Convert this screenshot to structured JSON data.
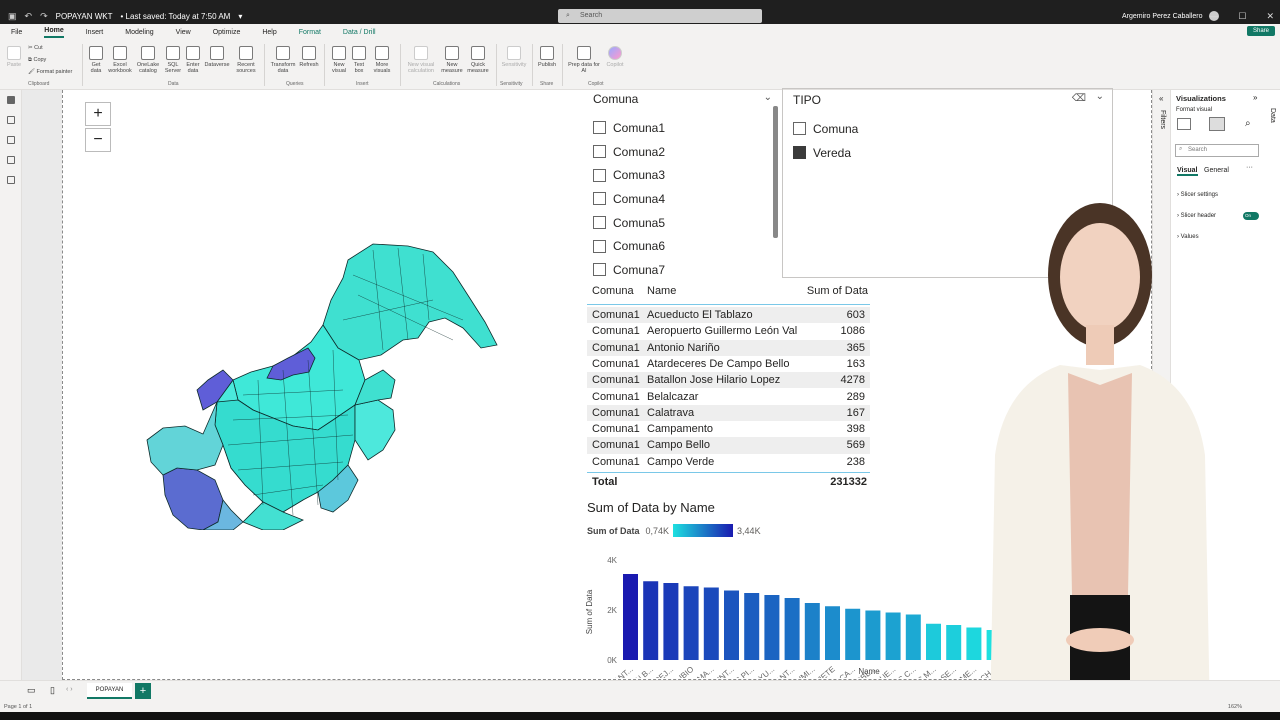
{
  "titlebar": {
    "file": "POPAYAN WKT",
    "saved": "• Last saved: Today at 7:50 AM",
    "search": "Search",
    "user": "Argemiro Perez Caballero",
    "share": "Share"
  },
  "menu": {
    "file": "File",
    "home": "Home",
    "insert": "Insert",
    "modeling": "Modeling",
    "view": "View",
    "optimize": "Optimize",
    "help": "Help",
    "format": "Format",
    "drill": "Data / Drill"
  },
  "ribbon": {
    "paste": "Paste",
    "cut": "Cut",
    "copy": "Copy",
    "format_painter": "Format painter",
    "get_data": "Get data",
    "excel": "Excel workbook",
    "onelake": "OneLake catalog",
    "sql": "SQL Server",
    "enter": "Enter data",
    "dataverse": "Dataverse",
    "recent": "Recent sources",
    "transform": "Transform data",
    "refresh": "Refresh",
    "new_visual": "New visual",
    "text_box": "Text box",
    "more_visuals": "More visuals",
    "new_calc": "New visual calculation",
    "new_measure": "New measure",
    "quick_measure": "Quick measure",
    "sensitivity": "Sensitivity",
    "publish": "Publish",
    "prep": "Prep data for AI",
    "copilot": "Copilot",
    "groups": {
      "clipboard": "Clipboard",
      "data": "Data",
      "queries": "Queries",
      "insert": "Insert",
      "calculations": "Calculations",
      "sensitivity": "Sensitivity",
      "share": "Share",
      "copilot": "Copilot"
    }
  },
  "map": {
    "zoom_in": "+",
    "zoom_out": "−"
  },
  "comuna_slicer": {
    "header": "Comuna",
    "items": [
      "Comuna1",
      "Comuna2",
      "Comuna3",
      "Comuna4",
      "Comuna5",
      "Comuna6",
      "Comuna7"
    ]
  },
  "tipo_slicer": {
    "header": "TIPO",
    "items": [
      {
        "label": "Comuna",
        "checked": false
      },
      {
        "label": "Vereda",
        "checked": true
      }
    ]
  },
  "table": {
    "headers": [
      "Comuna",
      "Name",
      "Sum of Data"
    ],
    "rows": [
      [
        "Comuna1",
        "Acueducto El Tablazo",
        "603"
      ],
      [
        "Comuna1",
        "Aeropuerto Guillermo León Val",
        "1086"
      ],
      [
        "Comuna1",
        "Antonio Nariño",
        "365"
      ],
      [
        "Comuna1",
        "Atardeceres De Campo Bello",
        "163"
      ],
      [
        "Comuna1",
        "Batallon Jose Hilario Lopez",
        "4278"
      ],
      [
        "Comuna1",
        "Belalcazar",
        "289"
      ],
      [
        "Comuna1",
        "Calatrava",
        "167"
      ],
      [
        "Comuna1",
        "Campamento",
        "398"
      ],
      [
        "Comuna1",
        "Campo Bello",
        "569"
      ],
      [
        "Comuna1",
        "Campo Verde",
        "238"
      ]
    ],
    "total_label": "Total",
    "total_value": "231332"
  },
  "chart_data": {
    "type": "bar",
    "title": "Sum of Data by Name",
    "xlabel": "Name",
    "ylabel": "Sum of Data",
    "legend_label": "Sum of Data",
    "legend_min": "0,74K",
    "legend_max": "3,44K",
    "yticks": [
      "0K",
      "2K",
      "4K"
    ],
    "ylim": [
      0,
      4000
    ],
    "categories": [
      "SANT...",
      "SAN B...",
      "LA REJ...",
      "CALIBIO",
      "SAMA...",
      "QUINT...",
      "LAS PI...",
      "LA YU...",
      "SANT...",
      "JULUMI...",
      "CAJETE",
      "EL CA...",
      "POBL...",
      "FIGUE...",
      "LOS C...",
      "LAS M...",
      "EL SE...",
      "LA ME...",
      "EL CH..."
    ],
    "values": [
      3440,
      3150,
      3080,
      2950,
      2900,
      2780,
      2680,
      2600,
      2480,
      2280,
      2150,
      2050,
      1980,
      1900,
      1820,
      1450,
      1400,
      1300,
      1200
    ]
  },
  "visualizations": {
    "title": "Visualizations",
    "format_visual": "Format visual",
    "search": "Search",
    "tab_visual": "Visual",
    "tab_general": "General",
    "slicer_settings": "Slicer settings",
    "slicer_header": "Slicer header",
    "values": "Values",
    "toggle": "On",
    "filters": "Filters",
    "data": "Data"
  },
  "bottom": {
    "tab": "POPAYAN",
    "page": "Page 1 of 1",
    "zoom": "162%"
  }
}
